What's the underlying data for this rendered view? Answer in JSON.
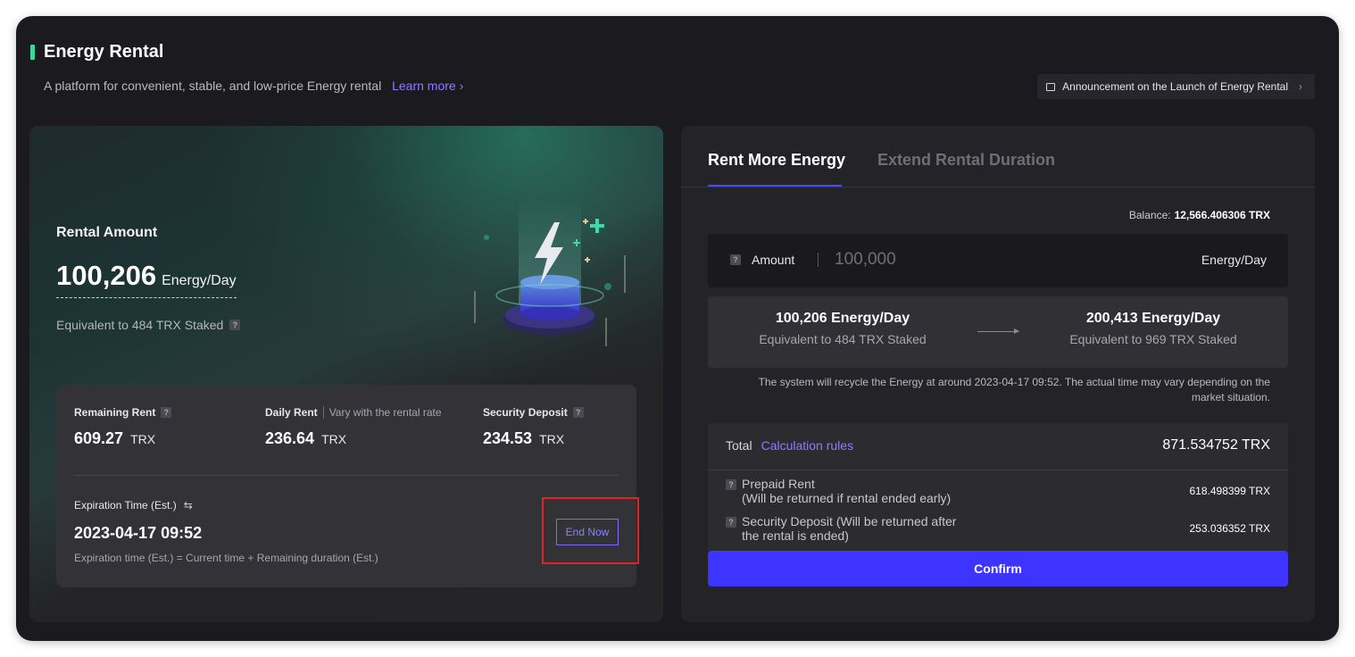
{
  "header": {
    "title": "Energy Rental",
    "subtitle": "A platform for convenient, stable, and low-price Energy rental",
    "learn_more": "Learn more",
    "announcement": "Announcement on the Launch of Energy Rental"
  },
  "rental": {
    "label": "Rental Amount",
    "amount": "100,206",
    "unit": "Energy/Day",
    "equivalent": "Equivalent to 484 TRX Staked"
  },
  "stats": {
    "remaining_rent": {
      "label": "Remaining Rent",
      "value": "609.27",
      "currency": "TRX"
    },
    "daily_rent": {
      "label": "Daily Rent",
      "sub": "Vary with the rental rate",
      "value": "236.64",
      "currency": "TRX"
    },
    "security_deposit": {
      "label": "Security Deposit",
      "value": "234.53",
      "currency": "TRX"
    },
    "expiration": {
      "label": "Expiration Time (Est.)",
      "value": "2023-04-17 09:52",
      "note": "Expiration time (Est.) = Current time + Remaining duration (Est.)"
    },
    "end_now": "End Now"
  },
  "right": {
    "tabs": [
      "Rent More Energy",
      "Extend Rental Duration"
    ],
    "balance_label": "Balance:",
    "balance_value": "12,566.406306 TRX",
    "amount_label": "Amount",
    "amount_placeholder": "100,000",
    "amount_unit": "Energy/Day",
    "current": {
      "energy": "100,206 Energy/Day",
      "equiv": "Equivalent to 484 TRX Staked"
    },
    "after": {
      "energy": "200,413 Energy/Day",
      "equiv": "Equivalent to 969 TRX Staked"
    },
    "notice": "The system will recycle the Energy at around 2023-04-17 09:52. The actual time may vary depending on the market situation.",
    "total_label": "Total",
    "calc_rules": "Calculation rules",
    "total_value": "871.534752 TRX",
    "prepaid_line1": "Prepaid Rent",
    "prepaid_line2": "(Will be returned if rental ended early)",
    "prepaid_value": "618.498399 TRX",
    "deposit_line1": "Security Deposit (Will be returned after",
    "deposit_line2": "the rental is ended)",
    "deposit_value": "253.036352 TRX",
    "confirm": "Confirm"
  },
  "colors": {
    "accent_green": "#3bd89c",
    "accent_purple": "#8c7cff",
    "confirm_blue": "#3e34ff",
    "highlight_red": "#e02424"
  }
}
